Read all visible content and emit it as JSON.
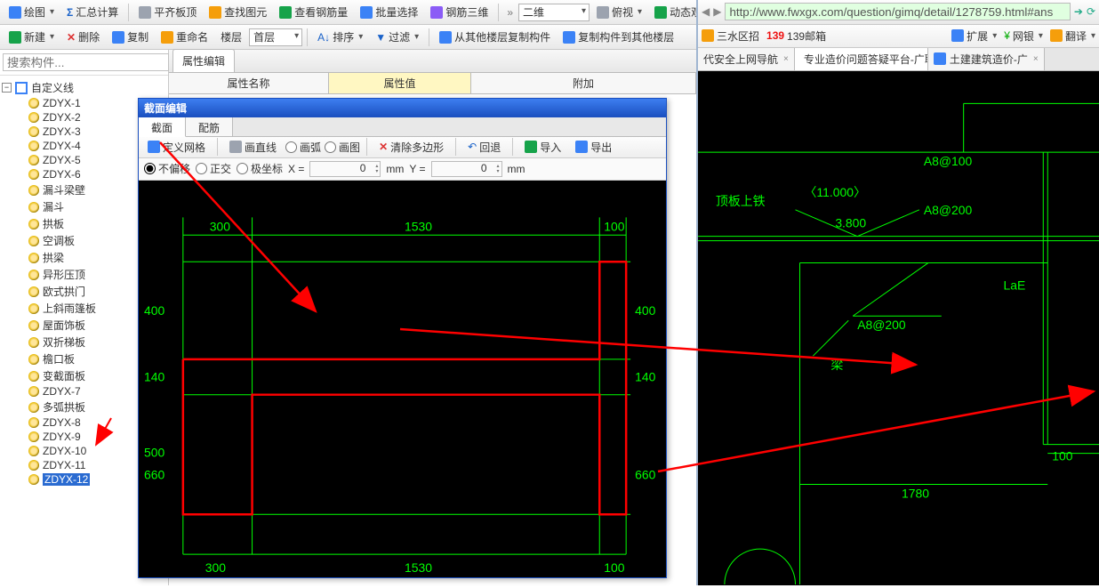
{
  "toolbar1": {
    "draw": "绘图",
    "sum": "汇总计算",
    "flat": "平齐板顶",
    "find": "查找图元",
    "rebar": "查看钢筋量",
    "batch": "批量选择",
    "rebar3d": "钢筋三维",
    "view2d": "二维",
    "top": "俯视",
    "dyn": "动态观察"
  },
  "toolbar2": {
    "new": "新建",
    "del": "删除",
    "copy": "复制",
    "rename": "重命名",
    "floor": "楼层",
    "floor1": "首层",
    "sort": "排序",
    "filter": "过滤",
    "copyfrom": "从其他楼层复制构件",
    "copyto": "复制构件到其他楼层"
  },
  "search": {
    "placeholder": "搜索构件..."
  },
  "tree": {
    "root": "自定义线",
    "items": [
      "ZDYX-1",
      "ZDYX-2",
      "ZDYX-3",
      "ZDYX-4",
      "ZDYX-5",
      "ZDYX-6",
      "漏斗梁壁",
      "漏斗",
      "拱板",
      "空调板",
      "拱梁",
      "异形压顶",
      "欧式拱门",
      "上斜雨篷板",
      "屋面饰板",
      "双折梯板",
      "檐口板",
      "变截面板",
      "ZDYX-7",
      "多弧拱板",
      "ZDYX-8",
      "ZDYX-9",
      "ZDYX-10",
      "ZDYX-11",
      "ZDYX-12"
    ],
    "selected": 24
  },
  "prop": {
    "tab": "属性编辑",
    "col1": "属性名称",
    "col2": "属性值",
    "col3": "附加"
  },
  "dialog": {
    "title": "截面编辑",
    "tabs": [
      "截面",
      "配筋"
    ],
    "tb": {
      "defgrid": "定义网格",
      "line": "画直线",
      "arc": "画弧",
      "img": "画图",
      "clear": "清除多边形",
      "undo": "回退",
      "import": "导入",
      "export": "导出"
    },
    "params": {
      "r1": "不偏移",
      "r2": "正交",
      "r3": "极坐标",
      "xlabel": "X =",
      "xval": "0",
      "xmm": "mm",
      "ylabel": "Y =",
      "yval": "0",
      "ymm": "mm"
    },
    "dims": {
      "w1": "300",
      "w2": "1530",
      "w3": "100",
      "h1": "400",
      "h2": "140",
      "h3": "500",
      "htot": "660",
      "h1r": "400",
      "h2r": "140",
      "htotr": "660",
      "bw1": "300",
      "bw2": "1530",
      "bw3": "100"
    }
  },
  "browser": {
    "url": "http://www.fwxgx.com/question/gimq/detail/1278759.html#ans",
    "bookmarks": {
      "sk": "三水区招",
      "mail": "139邮箱",
      "ext": "扩展",
      "bank": "网银",
      "trans": "翻译"
    },
    "tabs": [
      {
        "label": "代安全上网导航"
      },
      {
        "label": "专业造价问题答疑平台-广联达"
      },
      {
        "label": "土建建筑造价-广"
      }
    ],
    "cad": {
      "dingban": "顶板上铁",
      "a8_100": "A8@100",
      "a8_200a": "A8@200",
      "a8_200b": "A8@200",
      "eleven": "〈11.000〉",
      "elev": "3.800",
      "liang": "梁",
      "lae": "LaE",
      "w1780": "1780",
      "w100": "100"
    }
  }
}
